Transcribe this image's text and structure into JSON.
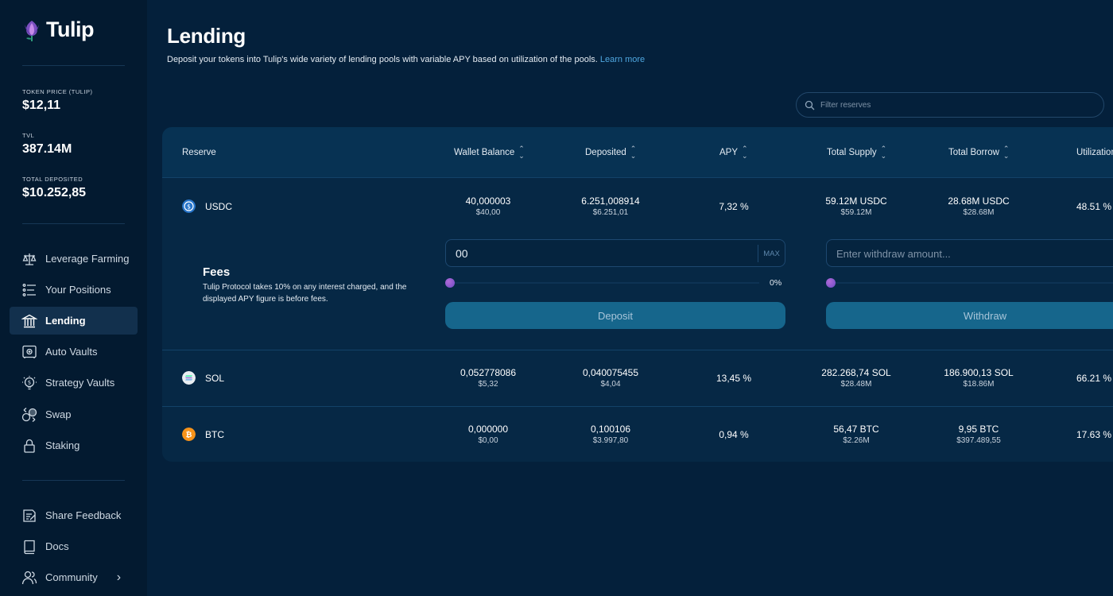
{
  "app": {
    "name": "Tulip"
  },
  "stats": [
    {
      "label": "TOKEN PRICE (TULIP)",
      "value": "$12,11"
    },
    {
      "label": "TVL",
      "value": "387.14M"
    },
    {
      "label": "TOTAL DEPOSITED",
      "value": "$10.252,85"
    }
  ],
  "nav": [
    {
      "label": "Leverage Farming",
      "icon": "scale-icon"
    },
    {
      "label": "Your Positions",
      "icon": "list-icon"
    },
    {
      "label": "Lending",
      "icon": "bank-icon",
      "active": true
    },
    {
      "label": "Auto Vaults",
      "icon": "safe-icon"
    },
    {
      "label": "Strategy Vaults",
      "icon": "bulb-dollar-icon"
    },
    {
      "label": "Swap",
      "icon": "swap-icon"
    },
    {
      "label": "Staking",
      "icon": "lock-icon"
    }
  ],
  "nav_bottom": [
    {
      "label": "Share Feedback",
      "icon": "feedback-icon"
    },
    {
      "label": "Docs",
      "icon": "book-icon"
    },
    {
      "label": "Community",
      "icon": "people-icon"
    }
  ],
  "page": {
    "title": "Lending",
    "subtitle": "Deposit your tokens into Tulip's wide variety of lending pools with variable APY based on utilization of the pools.",
    "learn_more": "Learn more"
  },
  "search": {
    "placeholder": "Filter reserves"
  },
  "table": {
    "headers": {
      "reserve": "Reserve",
      "wallet_balance": "Wallet Balance",
      "deposited": "Deposited",
      "apy": "APY",
      "total_supply": "Total Supply",
      "total_borrow": "Total Borrow",
      "utilization": "Utilization"
    },
    "rows": [
      {
        "asset": "USDC",
        "wallet": "40,000003",
        "wallet_usd": "$40,00",
        "deposited": "6.251,008914",
        "deposited_usd": "$6.251,01",
        "apy": "7,32 %",
        "supply": "59.12M USDC",
        "supply_usd": "$59.12M",
        "borrow": "28.68M USDC",
        "borrow_usd": "$28.68M",
        "utilization": "48.51 %"
      },
      {
        "asset": "SOL",
        "wallet": "0,052778086",
        "wallet_usd": "$5,32",
        "deposited": "0,040075455",
        "deposited_usd": "$4,04",
        "apy": "13,45 %",
        "supply": "282.268,74 SOL",
        "supply_usd": "$28.48M",
        "borrow": "186.900,13 SOL",
        "borrow_usd": "$18.86M",
        "utilization": "66.21 %"
      },
      {
        "asset": "BTC",
        "wallet": "0,000000",
        "wallet_usd": "$0,00",
        "deposited": "0,100106",
        "deposited_usd": "$3.997,80",
        "apy": "0,94 %",
        "supply": "56,47 BTC",
        "supply_usd": "$2.26M",
        "borrow": "9,95 BTC",
        "borrow_usd": "$397.489,55",
        "utilization": "17.63 %"
      }
    ]
  },
  "expanded": {
    "fees_title": "Fees",
    "fees_text": "Tulip Protocol takes 10% on any interest charged, and the displayed APY figure is before fees.",
    "deposit_value": "00",
    "max_label": "MAX",
    "deposit_pct": "0%",
    "deposit_slider_level": 0,
    "withdraw_placeholder": "Enter withdraw amount...",
    "withdraw_slider_level": 0,
    "deposit_button": "Deposit",
    "withdraw_button": "Withdraw"
  },
  "colors": {
    "background": "#04203b",
    "sidebar": "#031a30",
    "accent_button": "#16668c",
    "link": "#4fa7e0",
    "usdc": "#2775ca",
    "btc": "#f7931a"
  }
}
